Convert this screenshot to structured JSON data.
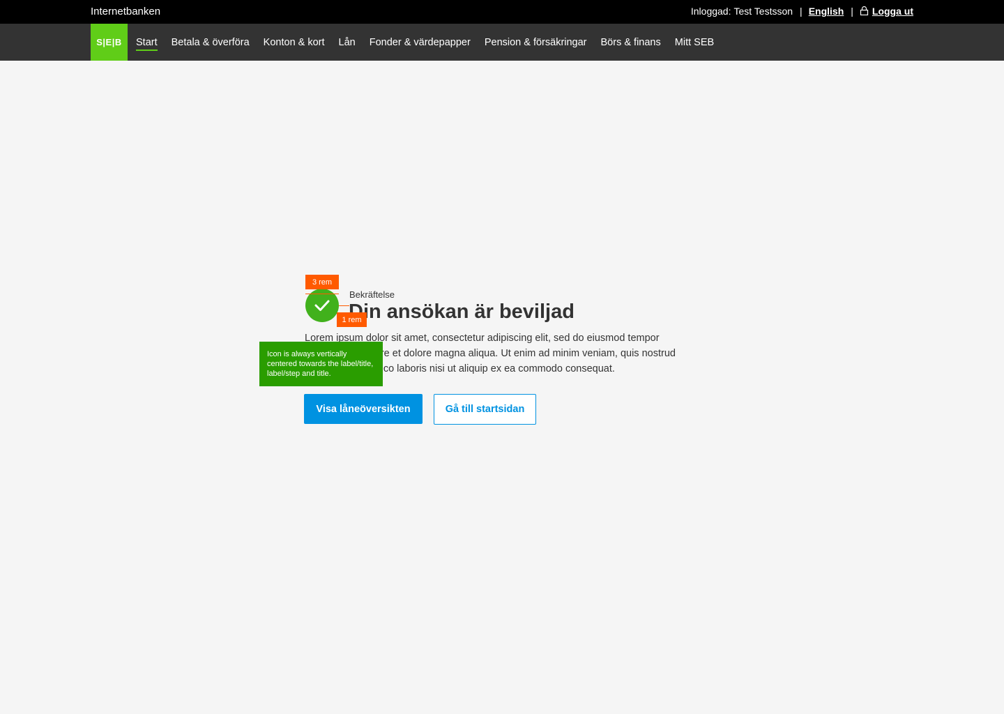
{
  "topbar": {
    "brand": "Internetbanken",
    "logged_in_label": "Inloggad:",
    "user_name": "Test Testsson",
    "separator": "|",
    "language_link": "English",
    "logout_label": "Logga ut"
  },
  "nav": {
    "logo_text": "S|E|B",
    "items": [
      {
        "label": "Start"
      },
      {
        "label": "Betala & överföra"
      },
      {
        "label": "Konton & kort"
      },
      {
        "label": "Lån"
      },
      {
        "label": "Fonder & värdepapper"
      },
      {
        "label": "Pension & försäkringar"
      },
      {
        "label": "Börs & finans"
      },
      {
        "label": "Mitt SEB"
      }
    ]
  },
  "confirmation": {
    "eyebrow": "Bekräftelse",
    "title": "Din ansökan är beviljad",
    "body": "Lorem ipsum dolor sit amet, consectetur adipiscing elit, sed do eiusmod tempor incididunt ut labore et dolore magna aliqua. Ut enim ad minim veniam, quis nostrud exercitation ullamco laboris nisi ut aliquip ex ea commodo consequat.",
    "primary_button": "Visa låneöversikten",
    "secondary_button": "Gå till startsidan"
  },
  "annotations": {
    "size_tag": "3 rem",
    "gap_tag": "1 rem",
    "note": "Icon is always vertically centered towards the label/title, label/step and title."
  },
  "colors": {
    "brand_green": "#60cd18",
    "success_green": "#41b11c",
    "primary_blue": "#0092e1",
    "annotation_orange": "#ff5a00",
    "annotation_green": "#2a9d00"
  }
}
